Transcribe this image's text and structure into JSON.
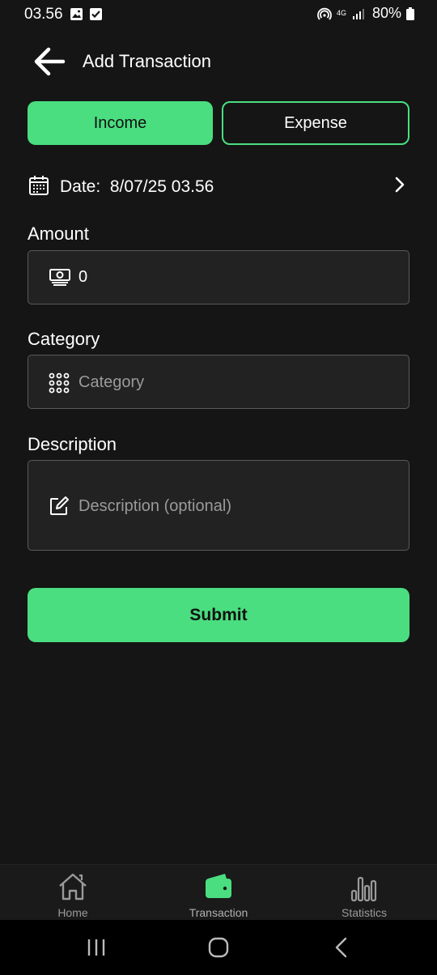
{
  "status_bar": {
    "time": "03.56",
    "network": "4G",
    "battery": "80%"
  },
  "header": {
    "title": "Add Transaction"
  },
  "type_toggle": {
    "income_label": "Income",
    "expense_label": "Expense",
    "selected": "Income"
  },
  "date": {
    "label": "Date:",
    "value": "8/07/25 03.56"
  },
  "amount": {
    "label": "Amount",
    "value": "0"
  },
  "category": {
    "label": "Category",
    "placeholder": "Category"
  },
  "description": {
    "label": "Description",
    "placeholder": "Description (optional)"
  },
  "submit_label": "Submit",
  "bottom_nav": {
    "items": [
      {
        "label": "Home",
        "icon": "home-icon"
      },
      {
        "label": "Transaction",
        "icon": "wallet-icon"
      },
      {
        "label": "Statistics",
        "icon": "bar-chart-icon"
      }
    ],
    "active": "Transaction"
  },
  "colors": {
    "accent": "#4ade80",
    "background": "#151515",
    "field": "#222222"
  }
}
